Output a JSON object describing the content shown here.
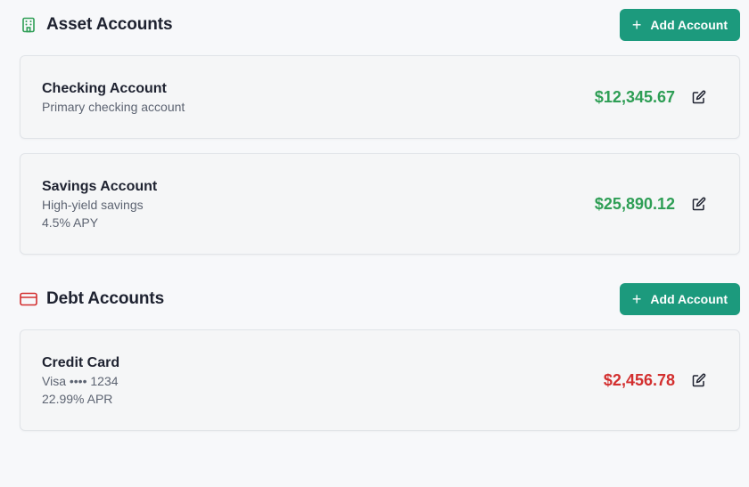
{
  "asset_section": {
    "title": "Asset Accounts",
    "icon": "building-icon",
    "icon_color": "#2e9e55",
    "add_label": "Add Account",
    "accounts": [
      {
        "name": "Checking Account",
        "description": "Primary checking account",
        "balance": "$12,345.67"
      },
      {
        "name": "Savings Account",
        "description": "High-yield savings",
        "rate": "4.5% APY",
        "balance": "$25,890.12"
      }
    ]
  },
  "debt_section": {
    "title": "Debt Accounts",
    "icon": "credit-card-icon",
    "icon_color": "#d32f2f",
    "add_label": "Add Account",
    "accounts": [
      {
        "name": "Credit Card",
        "description": "Visa •••• 1234",
        "rate": "22.99% APR",
        "balance": "$2,456.78"
      }
    ]
  },
  "colors": {
    "accent": "#1c9a7d",
    "positive": "#2e9e55",
    "negative": "#d32f2f"
  }
}
